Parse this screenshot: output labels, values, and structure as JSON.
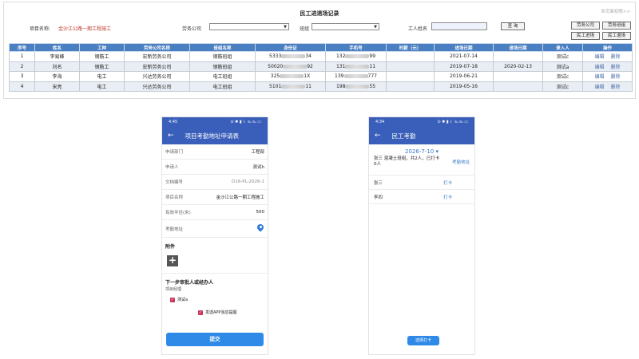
{
  "web": {
    "title": "民工进退场记录",
    "top_link": "本页面权限>>",
    "project_label": "项目名称:",
    "project_value": "金沙江公路一期工程施工",
    "labor_company_label": "劳务公司",
    "team_label": "班组",
    "worker_name_label": "工人姓名",
    "worker_name_value": "",
    "query_label": "查 询",
    "buttons": {
      "labor_company": "劳务公司",
      "labor_team": "劳务班组",
      "worker_enter": "民工进场",
      "worker_exit": "民工退场"
    },
    "table": {
      "headers": [
        "序号",
        "姓名",
        "工种",
        "劳务公司名称",
        "班组名称",
        "身份证",
        "手机号",
        "时薪（元）",
        "进场日期",
        "退场日期",
        "录入人",
        "操作"
      ],
      "rows": [
        [
          "1",
          "李易峰",
          "钢筋工",
          "宏新劳务公司",
          "钢筋班组",
          "5333",
          "34",
          "132",
          "99",
          "",
          "2021-07-14",
          "",
          "测试c"
        ],
        [
          "2",
          "刘名",
          "钢筋工",
          "宏新劳务公司",
          "钢筋班组",
          "50020",
          "92",
          "131",
          "11",
          "",
          "2019-07-18",
          "2020-02-13",
          "测试a"
        ],
        [
          "3",
          "李海",
          "电工",
          "兴达劳务公司",
          "电工班组",
          "325",
          "1X",
          "139",
          "777",
          "",
          "2019-06-21",
          "",
          "测试c"
        ],
        [
          "4",
          "宋亮",
          "电工",
          "兴达劳务公司",
          "电工班组",
          "5101",
          "11",
          "198",
          "55",
          "",
          "2019-05-16",
          "",
          "测试c"
        ]
      ],
      "edit_label": "编辑",
      "delete_label": "删除"
    }
  },
  "phone1": {
    "time": "4:45",
    "status_icons": "⊙ ✱ ▮ ☾ 𝗌ᵢᵢ 𝗌ᵢᵢ ▭",
    "title": "项目考勤地址申请表",
    "fields": [
      {
        "label": "申请部门",
        "value": "工程部"
      },
      {
        "label": "申请人",
        "value": "测试h"
      },
      {
        "label": "文档编号",
        "value": "D16-PL-2026-1"
      },
      {
        "label": "项目名称",
        "value": "金沙江公路一期工程施工"
      },
      {
        "label": "有效半径(米)",
        "value": "500"
      }
    ],
    "address_label": "考勤地址",
    "attachment_label": "附件",
    "next_step_label": "下一步审批人或经办人",
    "next_step_sub": "项目经理",
    "approver_label": "测试a",
    "notify_label": "发送APP消息提醒",
    "submit_label": "提交"
  },
  "phone2": {
    "time": "4:34",
    "status_icons": "⊙ ✱ ▮ ☾ 𝗌ᵢᵢ 𝗌ᵢᵢ ▭",
    "title": "民工考勤",
    "date": "2026-7-10",
    "summary": "张三 混凝土班组，共2人，已打卡0人",
    "address_link": "考勤地址",
    "workers": [
      {
        "name": "张三",
        "action": "打卡"
      },
      {
        "name": "李四",
        "action": "打卡"
      }
    ],
    "bottom_button": "选择打卡"
  }
}
